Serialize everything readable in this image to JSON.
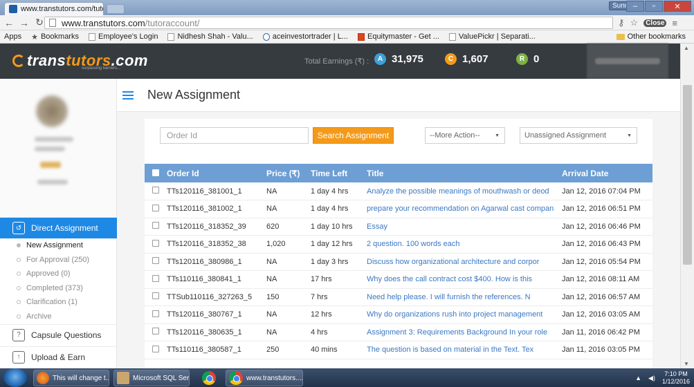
{
  "browser": {
    "tab_title": "www.transtutors.com/tuto",
    "tab_close": "×",
    "user_name": "Sunny",
    "url_host": "www.transtutors.com",
    "url_path": "/tutoraccount/",
    "ext_label": "Close",
    "bookmarks": [
      {
        "label": "Apps",
        "icon": "apps-grid-icon"
      },
      {
        "label": "Bookmarks",
        "icon": "star-icon"
      },
      {
        "label": "Employee's Login",
        "icon": "page-icon"
      },
      {
        "label": "Nidhesh Shah - Valu...",
        "icon": "page-icon"
      },
      {
        "label": "aceinvestortrader | L...",
        "icon": "wordpress-icon"
      },
      {
        "label": "Equitymaster - Get ...",
        "icon": "equitymaster-icon"
      },
      {
        "label": "ValuePickr | Separati...",
        "icon": "page-icon"
      }
    ],
    "other_bookmarks": "Other bookmarks"
  },
  "header": {
    "logo_main": "trans",
    "logo_accent": "tutors",
    "logo_suffix": ".com",
    "tagline": "surpassing barriers...",
    "earnings_label": "Total Earnings (₹) :",
    "earnings": [
      {
        "badge": "A",
        "value": "31,975",
        "color": "#3ea0d8"
      },
      {
        "badge": "C",
        "value": "1,607",
        "color": "#f49a1a"
      },
      {
        "badge": "R",
        "value": "0",
        "color": "#7cb342"
      }
    ]
  },
  "sidebar": {
    "active_item": "Direct Assignment",
    "sub_items": [
      {
        "label": "New Assignment",
        "active": true
      },
      {
        "label": "For Approval (250)",
        "active": false
      },
      {
        "label": "Approved (0)",
        "active": false
      },
      {
        "label": "Completed (373)",
        "active": false
      },
      {
        "label": "Clarification (1)",
        "active": false
      },
      {
        "label": "Archive",
        "active": false
      }
    ],
    "items": [
      {
        "label": "Capsule Questions"
      },
      {
        "label": "Upload & Earn"
      }
    ]
  },
  "main": {
    "title": "New Assignment",
    "order_placeholder": "Order Id",
    "search_button": "Search Assignment",
    "more_action": "--More Action--",
    "filter": "Unassigned Assignment",
    "columns": [
      "Order Id",
      "Price (₹)",
      "Time Left",
      "Title",
      "Arrival Date"
    ],
    "rows": [
      {
        "order": "TTs120116_381001_1",
        "price": "NA",
        "time": "1 day 4 hrs",
        "title": "Analyze the possible meanings of mouthwash or deod",
        "date": "Jan 12, 2016 07:04 PM"
      },
      {
        "order": "TTs120116_381002_1",
        "price": "NA",
        "time": "1 day 4 hrs",
        "title": "prepare your recommendation on Agarwal cast compan",
        "date": "Jan 12, 2016 06:51 PM"
      },
      {
        "order": "TTs120116_318352_39",
        "price": "620",
        "time": "1 day 10 hrs",
        "title": "Essay",
        "date": "Jan 12, 2016 06:46 PM"
      },
      {
        "order": "TTs120116_318352_38",
        "price": "1,020",
        "time": "1 day 12 hrs",
        "title": "2 question. 100 words each",
        "date": "Jan 12, 2016 06:43 PM"
      },
      {
        "order": "TTs120116_380986_1",
        "price": "NA",
        "time": "1 day 3 hrs",
        "title": "Discuss how organizational architecture and corpor",
        "date": "Jan 12, 2016 05:54 PM"
      },
      {
        "order": "TTs110116_380841_1",
        "price": "NA",
        "time": "17 hrs",
        "title": "Why does the call contract cost $400. How is this",
        "date": "Jan 12, 2016 08:11 AM"
      },
      {
        "order": "TTSub110116_327263_5",
        "price": "150",
        "time": "7 hrs",
        "title": "Need help please. I will furnish the references. N",
        "date": "Jan 12, 2016 06:57 AM"
      },
      {
        "order": "TTs120116_380767_1",
        "price": "NA",
        "time": "12 hrs",
        "title": "Why do organizations rush into project management",
        "date": "Jan 12, 2016 03:05 AM"
      },
      {
        "order": "TTs120116_380635_1",
        "price": "NA",
        "time": "4 hrs",
        "title": "Assignment 3: Requirements Background In your role",
        "date": "Jan 11, 2016 06:42 PM"
      },
      {
        "order": "TTs110116_380587_1",
        "price": "250",
        "time": "40 mins",
        "title": "The question is based on material in the Text. Tex",
        "date": "Jan 11, 2016 03:05 PM"
      }
    ]
  },
  "taskbar": {
    "tasks": [
      "This will change t...",
      "Microsoft SQL Ser...",
      "www.transtutors...."
    ],
    "time": "7:10 PM",
    "date": "1/12/2016"
  }
}
